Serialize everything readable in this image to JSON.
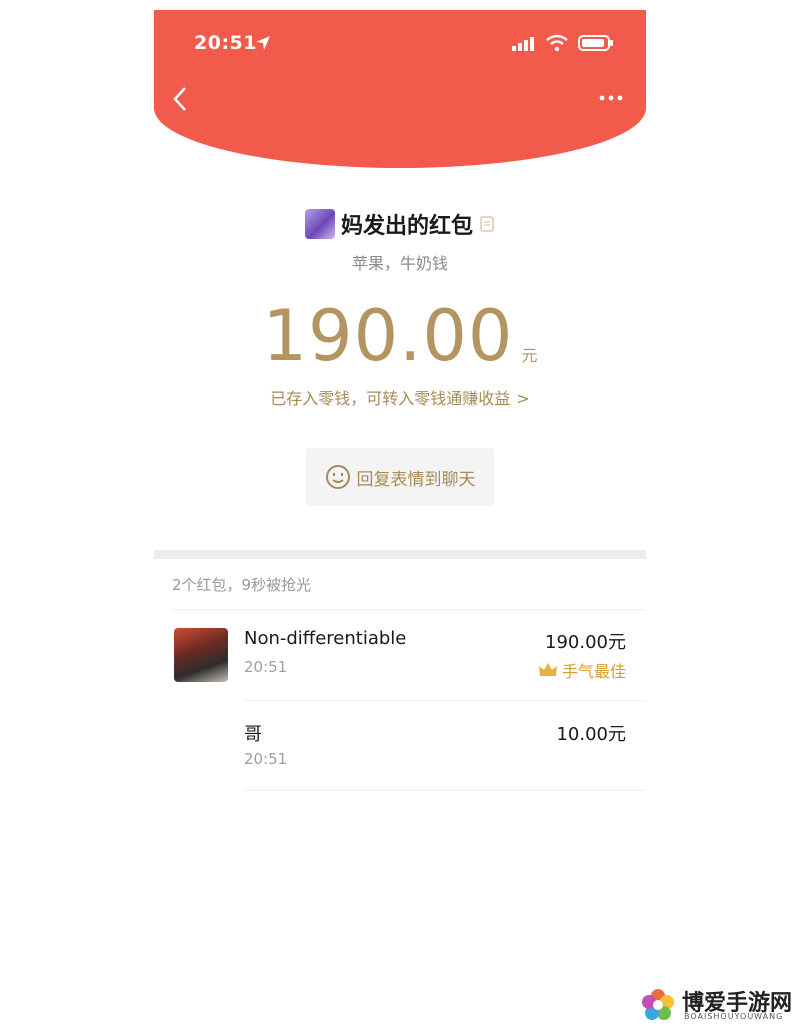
{
  "status_bar": {
    "time": "20:51"
  },
  "header": {
    "background": "#f25a4c"
  },
  "packet": {
    "sender_title": "妈发出的红包",
    "greeting": "苹果，牛奶钱",
    "amount": "190.00",
    "amount_unit": "元",
    "saved_text": "已存入零钱，可转入零钱通赚收益",
    "reply_label": "回复表情到聊天"
  },
  "claims": {
    "summary": "2个红包，9秒被抢光",
    "rows": [
      {
        "name": "Non-differentiable",
        "time": "20:51",
        "amount": "190.00元",
        "badge": "手气最佳"
      },
      {
        "name": "哥",
        "time": "20:51",
        "amount": "10.00元"
      }
    ]
  },
  "watermark": {
    "title": "博爱手游网",
    "subtitle": "BOAISHOUYOUWANG"
  },
  "colors": {
    "accent_gold": "#b49561",
    "red": "#f25a4c",
    "best_gold": "#d4a032"
  }
}
